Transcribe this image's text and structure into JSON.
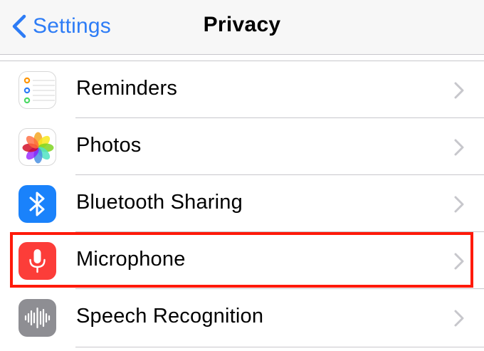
{
  "nav": {
    "back_label": "Settings",
    "title": "Privacy"
  },
  "colors": {
    "accent": "#2d7cf6",
    "nav_background": "#f7f7f7",
    "separator": "#c8c7cc",
    "highlight": "#ff1a0a",
    "chevron": "#c7c7cc"
  },
  "rows": [
    {
      "label": "Reminders",
      "icon": "reminders-icon"
    },
    {
      "label": "Photos",
      "icon": "photos-icon"
    },
    {
      "label": "Bluetooth Sharing",
      "icon": "bluetooth-icon"
    },
    {
      "label": "Microphone",
      "icon": "microphone-icon",
      "highlighted": true
    },
    {
      "label": "Speech Recognition",
      "icon": "speech-recognition-icon"
    }
  ]
}
